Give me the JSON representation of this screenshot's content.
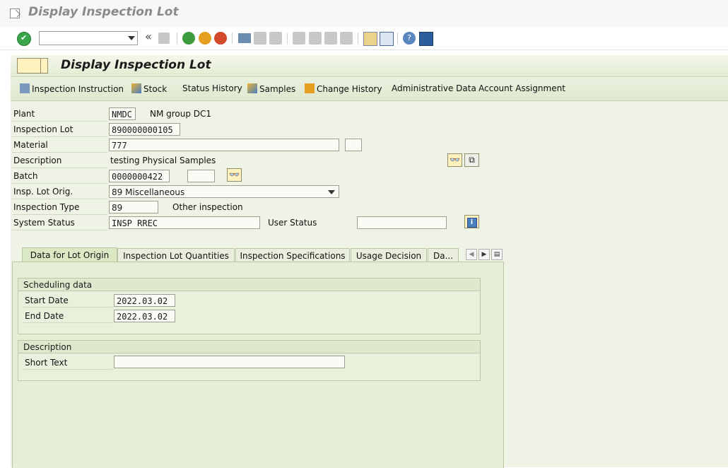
{
  "window": {
    "title": "Display Inspection Lot"
  },
  "toolbar": {
    "command_field_value": "",
    "icons": [
      "enter-icon",
      "save-icon",
      "back-icon",
      "exit-icon",
      "cancel-icon",
      "print-icon",
      "find-icon",
      "find-next-icon",
      "first-page-icon",
      "previous-page-icon",
      "next-page-icon",
      "last-page-icon",
      "create-session-icon",
      "shortcut-icon",
      "help-icon",
      "customize-layout-icon"
    ]
  },
  "header": {
    "title": "Display Inspection Lot"
  },
  "appbar": {
    "inspection_instruction": "Inspection Instruction",
    "stock": "Stock",
    "status_history": "Status History",
    "samples": "Samples",
    "change_history": "Change History",
    "administrative_data": "Administrative Data",
    "account_assignment": "Account Assignment"
  },
  "form": {
    "plant": {
      "label": "Plant",
      "value": "NMDC",
      "text": "NM group DC1"
    },
    "inspection_lot": {
      "label": "Inspection Lot",
      "value": "890000000105"
    },
    "material": {
      "label": "Material",
      "value": "777",
      "extra": ""
    },
    "description": {
      "label": "Description",
      "value": "testing Physical Samples"
    },
    "batch": {
      "label": "Batch",
      "value": "0000000422",
      "extra": ""
    },
    "insp_lot_orig": {
      "label": "Insp. Lot Orig.",
      "value": "89 Miscellaneous"
    },
    "inspection_type": {
      "label": "Inspection Type",
      "value": "89",
      "text": "Other inspection"
    },
    "system_status": {
      "label": "System Status",
      "value": "INSP RREC"
    },
    "user_status": {
      "label": "User Status",
      "value": ""
    }
  },
  "tabs": [
    {
      "label": "Data for Lot Origin",
      "active": true
    },
    {
      "label": "Inspection Lot Quantities",
      "active": false
    },
    {
      "label": "Inspection Specifications",
      "active": false
    },
    {
      "label": "Usage Decision",
      "active": false
    },
    {
      "label": "Da...",
      "active": false
    }
  ],
  "scheduling": {
    "title": "Scheduling data",
    "start_date_label": "Start Date",
    "start_date": "2022.03.02",
    "end_date_label": "End Date",
    "end_date": "2022.03.02"
  },
  "description_group": {
    "title": "Description",
    "short_text_label": "Short Text",
    "short_text": ""
  },
  "colors": {
    "panel_green": "#eef3e5",
    "tab_active": "#dbe8c4",
    "button_yellow": "#fff2bf"
  }
}
